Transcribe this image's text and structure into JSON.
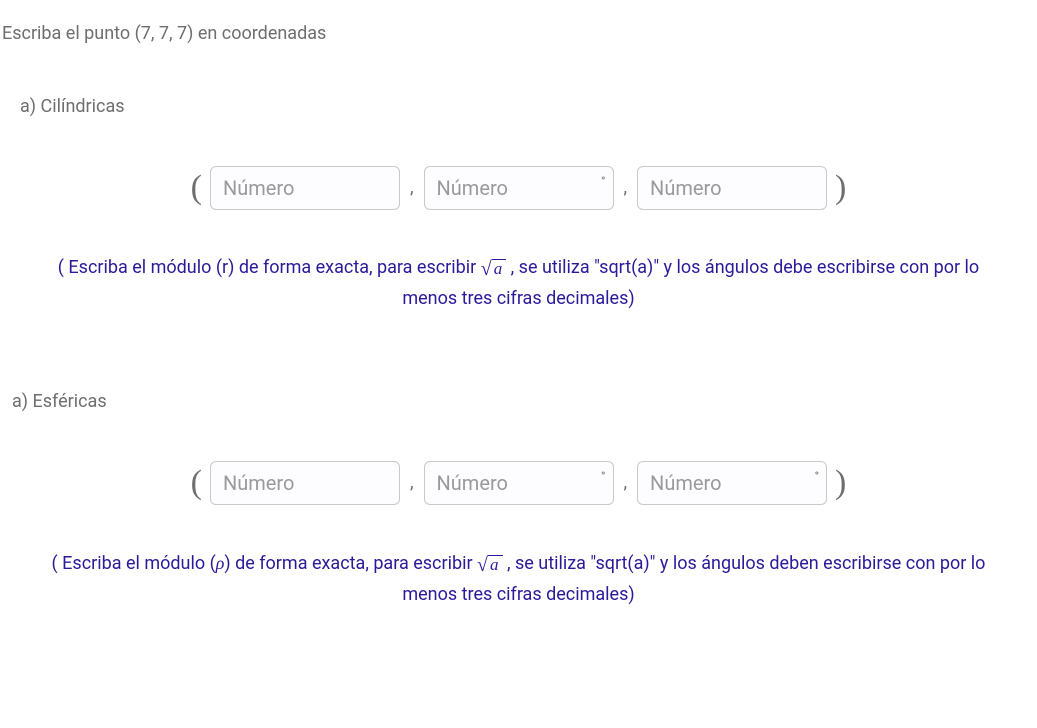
{
  "prompt": "Escriba el punto (7, 7, 7) en coordenadas",
  "placeholder": "Número",
  "partA": {
    "label": "a) Cilíndricas",
    "hint_before": "( Escriba el módulo (r) de forma exacta, para escribir ",
    "sqrt_arg": "a",
    "hint_after": " , se utiliza \"sqrt(a)\" y los ángulos debe escribirse con por lo menos tres cifras decimales)"
  },
  "partB": {
    "label": "a) Esféricas",
    "hint_before": "( Escriba el módulo (",
    "rho": "ρ",
    "hint_mid": ") de forma exacta, para escribir ",
    "sqrt_arg": "a",
    "hint_after": " , se utiliza \"sqrt(a)\" y los ángulos deben escribirse con por lo menos tres cifras decimales)"
  }
}
